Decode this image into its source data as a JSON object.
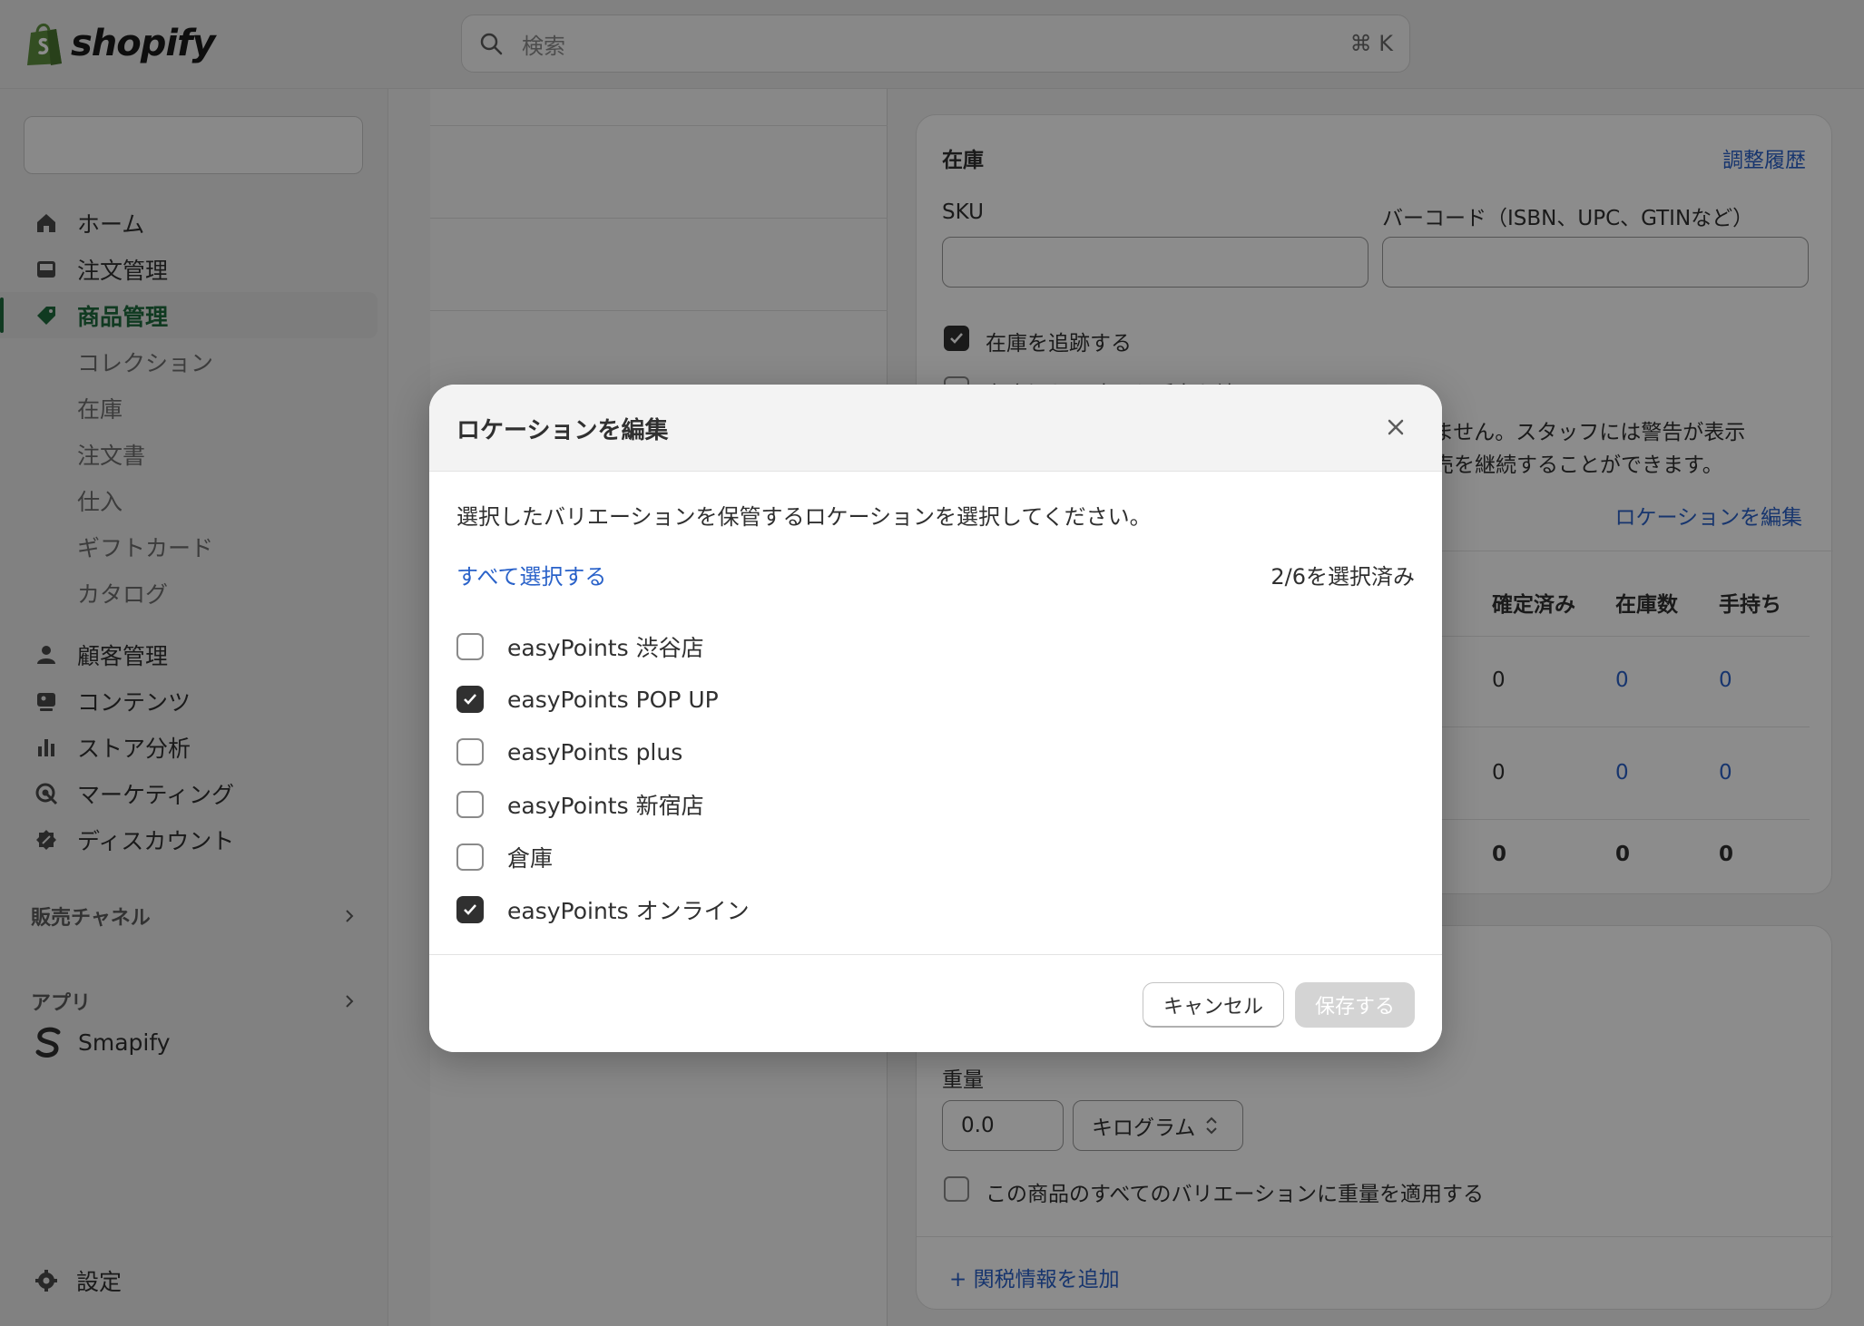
{
  "topbar": {
    "logo_text": "shopify",
    "search_placeholder": "検索",
    "search_shortcut": "⌘ K"
  },
  "sidebar": {
    "nav": [
      {
        "label": "ホーム",
        "icon": "home-icon"
      },
      {
        "label": "注文管理",
        "icon": "inbox-icon"
      },
      {
        "label": "商品管理",
        "icon": "tag-icon",
        "active": true
      }
    ],
    "product_sub": [
      "コレクション",
      "在庫",
      "注文書",
      "仕入",
      "ギフトカード",
      "カタログ"
    ],
    "nav2": [
      {
        "label": "顧客管理",
        "icon": "person-icon"
      },
      {
        "label": "コンテンツ",
        "icon": "content-icon"
      },
      {
        "label": "ストア分析",
        "icon": "bar-chart-icon"
      },
      {
        "label": "マーケティング",
        "icon": "target-icon"
      },
      {
        "label": "ディスカウント",
        "icon": "discount-icon"
      }
    ],
    "sales_channels": "販売チャネル",
    "apps": "アプリ",
    "app_smapify": "Smapify",
    "settings": "設定"
  },
  "inventory": {
    "title": "在庫",
    "history_link": "調整履歴",
    "sku_label": "SKU",
    "barcode_label": "バーコード（ISBN、UPC、GTINなど）",
    "track_label": "在庫を追跡する",
    "continue_label": "在庫切れの時でも販売を続ける",
    "notice_line1": "りません。スタッフには警告が表示",
    "notice_line2": "販売を継続することができます。",
    "edit_locations_link": "ロケーションを編集",
    "columns": [
      "確定済み",
      "在庫数",
      "手持ち"
    ],
    "rows": [
      [
        "0",
        "0",
        "0"
      ],
      [
        "0",
        "0",
        "0"
      ],
      [
        "0",
        "0",
        "0"
      ]
    ]
  },
  "shipping": {
    "weight_label": "重量",
    "weight_value": "0.0",
    "unit_value": "キログラム",
    "apply_all_label": "この商品のすべてのバリエーションに重量を適用する",
    "customs_link": "関税情報を追加"
  },
  "modal": {
    "title": "ロケーションを編集",
    "description": "選択したバリエーションを保管するロケーションを選択してください。",
    "select_all": "すべて選択する",
    "selected_count": "2/6を選択済み",
    "locations": [
      {
        "label": "easyPoints 渋谷店",
        "checked": false
      },
      {
        "label": "easyPoints POP UP",
        "checked": true
      },
      {
        "label": "easyPoints plus",
        "checked": false
      },
      {
        "label": "easyPoints 新宿店",
        "checked": false
      },
      {
        "label": "倉庫",
        "checked": false
      },
      {
        "label": "easyPoints オンライン",
        "checked": true
      }
    ],
    "cancel_label": "キャンセル",
    "save_label": "保存する"
  },
  "colors": {
    "accent_green": "#1e6b3c",
    "link_blue": "#2a62c9",
    "logo_green": "#5e8e3e"
  }
}
